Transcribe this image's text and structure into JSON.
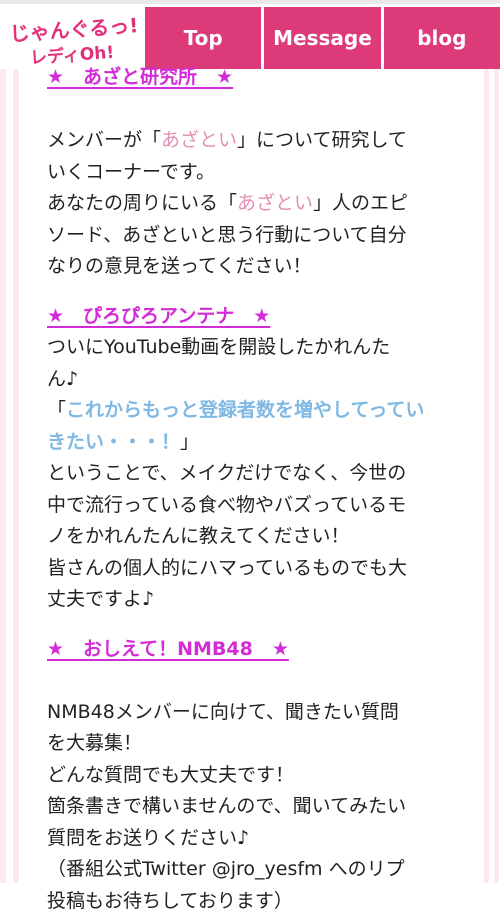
{
  "header": {
    "logo_text": "じゃんぐるっ! レディOh!",
    "nav": [
      {
        "label": "Top"
      },
      {
        "label": "Message"
      },
      {
        "label": "blog"
      }
    ]
  },
  "colors": {
    "accent": "#dd3a7a",
    "heading": "#d42bd8",
    "quote_pink": "#e38fb6",
    "quote_blue": "#7fb9e3"
  },
  "sections": {
    "azatoi": {
      "heading": "★　あざと研究所　★",
      "line1_a": "メンバーが「",
      "line1_b": "あざとい",
      "line1_c": "」について研究して",
      "line2": "いくコーナーです。",
      "line3_a": "あなたの周りにいる「",
      "line3_b": "あざとい",
      "line3_c": "」人のエピ",
      "line4": "ソード、あざといと思う行動について自分",
      "line5": "なりの意見を送ってください！"
    },
    "antenna": {
      "heading": "★　ぴろぴろアンテナ　★",
      "line1": "ついにYouTube動画を開設したかれんた",
      "line2": "ん♪",
      "quote_open": "「",
      "quote1": "これからもっと登録者数を増やしてってい",
      "quote2": "きたい・・・！",
      "quote_close": "」",
      "line3": "ということで、メイクだけでなく、今世の",
      "line4": "中で流行っている食べ物やバズっているモ",
      "line5": "ノをかれんたんに教えてください！",
      "line6": "皆さんの個人的にハマっているものでも大",
      "line7": "丈夫ですよ♪"
    },
    "oshiete": {
      "heading": "★　おしえて！NMB48　★",
      "line1": "NMB48メンバーに向けて、聞きたい質問",
      "line2": "を大募集！",
      "line3": "どんな質問でも大丈夫です！",
      "line4": "箇条書きで構いませんので、聞いてみたい",
      "line5": "質問をお送りください♪",
      "line6": "（番組公式Twitter @jro_yesfm へのリプ",
      "line7": "投稿もお待ちしております）"
    }
  }
}
